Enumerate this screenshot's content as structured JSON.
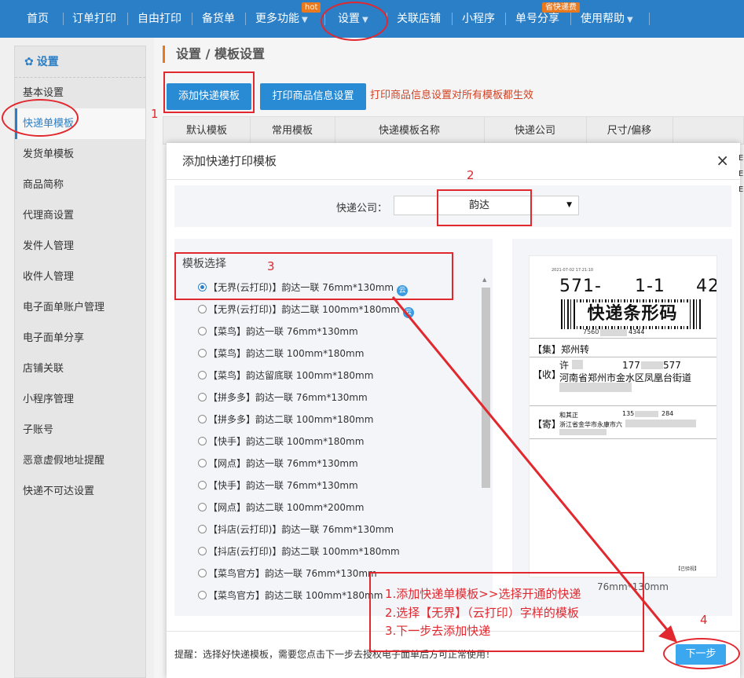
{
  "nav": {
    "items": [
      {
        "label": "首页"
      },
      {
        "label": "订单打印"
      },
      {
        "label": "自由打印"
      },
      {
        "label": "备货单"
      },
      {
        "label": "更多功能"
      },
      {
        "label": "设置"
      },
      {
        "label": "关联店铺"
      },
      {
        "label": "小程序"
      },
      {
        "label": "单号分享"
      },
      {
        "label": "使用帮助"
      }
    ],
    "hot_badge": "hot",
    "ship_badge": "省快递费"
  },
  "sidebar": {
    "title": "设置",
    "items": [
      {
        "label": "基本设置"
      },
      {
        "label": "快递单模板"
      },
      {
        "label": "发货单模板"
      },
      {
        "label": "商品简称"
      },
      {
        "label": "代理商设置"
      },
      {
        "label": "发件人管理"
      },
      {
        "label": "收件人管理"
      },
      {
        "label": "电子面单账户管理"
      },
      {
        "label": "电子面单分享"
      },
      {
        "label": "店铺关联"
      },
      {
        "label": "小程序管理"
      },
      {
        "label": "子账号"
      },
      {
        "label": "恶意虚假地址提醒"
      },
      {
        "label": "快递不可达设置"
      }
    ]
  },
  "breadcrumb": "设置 / 模板设置",
  "toolbar": {
    "add_button": "添加快递模板",
    "print_info_button": "打印商品信息设置",
    "hint": "打印商品信息设置对所有模板都生效"
  },
  "table": {
    "headers": [
      "默认模板",
      "常用模板",
      "快递模板名称",
      "快递公司",
      "尺寸/偏移"
    ]
  },
  "modal": {
    "title": "添加快递打印模板",
    "close": "×",
    "company_label": "快递公司：",
    "company_value": "韵达",
    "template_label": "模板选择",
    "options": [
      {
        "label": "【无界(云打印)】韵达一联 76mm*130mm",
        "checked": true,
        "cloud": true
      },
      {
        "label": "【无界(云打印)】韵达二联 100mm*180mm",
        "checked": false,
        "cloud": true
      },
      {
        "label": "【菜鸟】韵达一联 76mm*130mm",
        "checked": false,
        "cloud": false
      },
      {
        "label": "【菜鸟】韵达二联 100mm*180mm",
        "checked": false,
        "cloud": false
      },
      {
        "label": "【菜鸟】韵达留底联 100mm*180mm",
        "checked": false,
        "cloud": false
      },
      {
        "label": "【拼多多】韵达一联 76mm*130mm",
        "checked": false,
        "cloud": false
      },
      {
        "label": "【拼多多】韵达二联 100mm*180mm",
        "checked": false,
        "cloud": false
      },
      {
        "label": "【快手】韵达二联 100mm*180mm",
        "checked": false,
        "cloud": false
      },
      {
        "label": "【网点】韵达一联 76mm*130mm",
        "checked": false,
        "cloud": false
      },
      {
        "label": "【快手】韵达一联 76mm*130mm",
        "checked": false,
        "cloud": false
      },
      {
        "label": "【网点】韵达二联 100mm*200mm",
        "checked": false,
        "cloud": false
      },
      {
        "label": "【抖店(云打印)】韵达一联 76mm*130mm",
        "checked": false,
        "cloud": false
      },
      {
        "label": "【抖店(云打印)】韵达二联 100mm*180mm",
        "checked": false,
        "cloud": false
      },
      {
        "label": "【菜鸟官方】韵达一联 76mm*130mm",
        "checked": false,
        "cloud": false
      },
      {
        "label": "【菜鸟官方】韵达二联 100mm*180mm",
        "checked": false,
        "cloud": false
      }
    ],
    "preview": {
      "date": "2021-07-02 17:21:10",
      "code_a": "571-",
      "code_b": "1-1",
      "code_c": "42",
      "barcode_text": "快递条形码",
      "barcode_num_a": "7560",
      "barcode_num_b": "4344",
      "dist_tag": "【集】",
      "dist_value": "郑州转",
      "recv_tag": "【收】",
      "recv_name": "许",
      "recv_phone_a": "177",
      "recv_phone_b": "577",
      "recv_addr": "河南省郑州市金水区凤凰台街道",
      "send_tag": "【寄】",
      "send_name": "和其正",
      "send_phone_a": "135",
      "send_phone_b": "284",
      "send_addr": "浙江省金华市永康市六",
      "signed_tag": "【已验视】",
      "size": "76mm*130mm"
    },
    "footer_hint": "提醒：选择好快递模板，需要您点击下一步去授权电子面单后方可正常使用！",
    "next_button": "下一步"
  },
  "annotations": {
    "num1": "1",
    "num2": "2",
    "num3": "3",
    "num4": "4",
    "notes": [
      "1.添加快递单模板>>选择开通的快递",
      "2.选择【无界】（云打印）字样的模板",
      "3.下一步去添加快递"
    ]
  },
  "colors": {
    "nav_bg": "#2a7fc7",
    "accent_blue": "#2a8bd5",
    "hint_red": "#d43f1f",
    "annotation_red": "#e0282e"
  }
}
